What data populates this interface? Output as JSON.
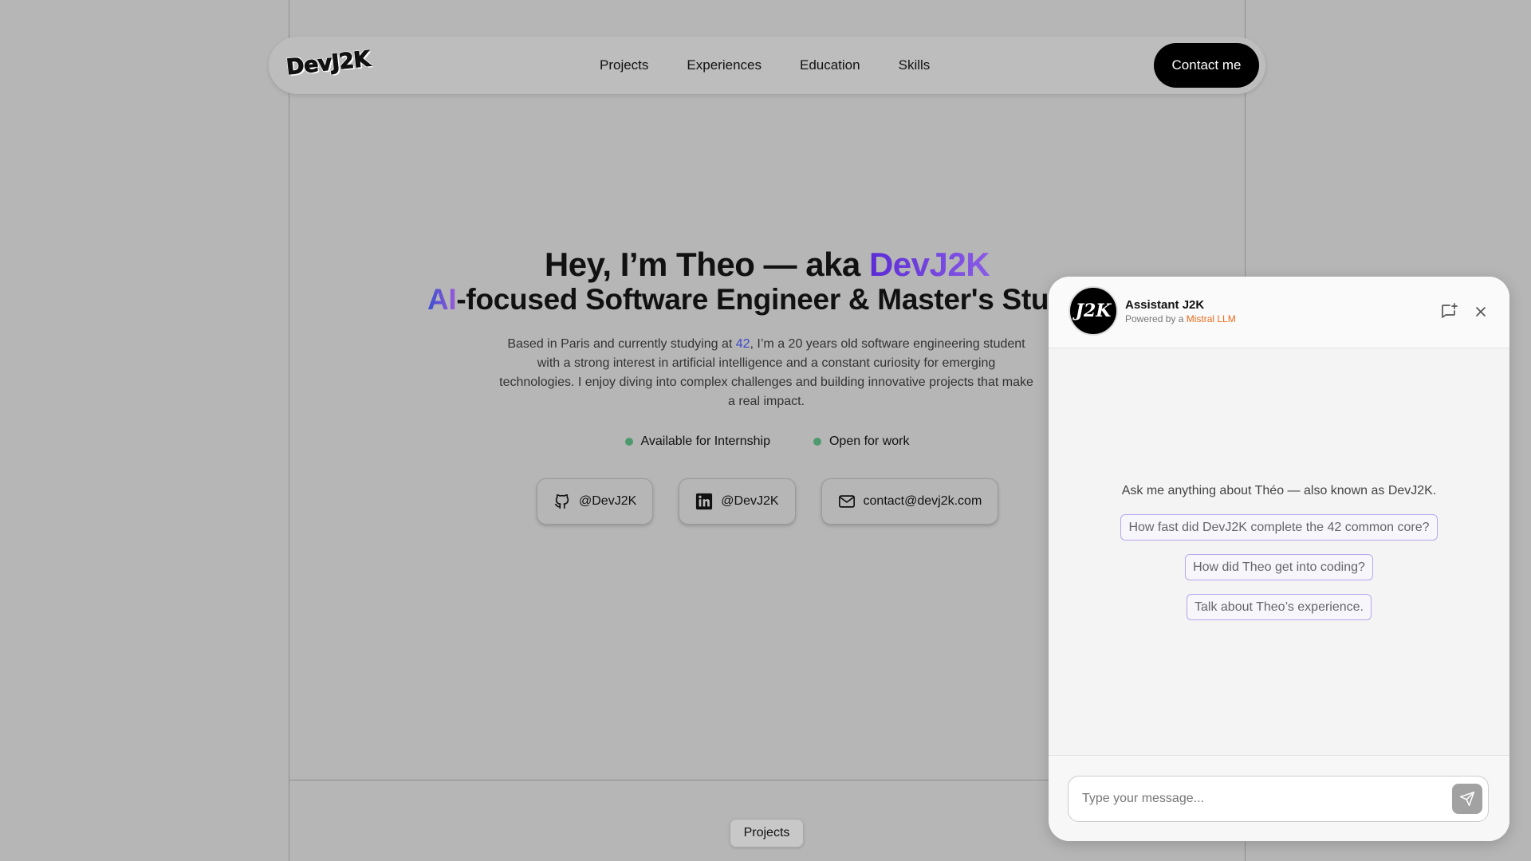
{
  "nav": {
    "logo": "DevJ2K",
    "links": [
      "Projects",
      "Experiences",
      "Education",
      "Skills"
    ],
    "contact_label": "Contact me"
  },
  "hero": {
    "title_prefix": "Hey, I’m Theo — aka ",
    "title_accent": "DevJ2K",
    "subtitle_ai": "AI",
    "subtitle_rest": "-focused Software Engineer & Master's Student",
    "desc_before": "Based in Paris and currently studying at ",
    "desc_link": "42",
    "desc_after": ", I’m a 20 years old software engineering student with a strong interest in artificial intelligence and a constant curiosity for emerging technologies. I enjoy diving into complex challenges and building innovative projects that make a real impact.",
    "status": [
      "Available for Internship",
      "Open for work"
    ],
    "socials": {
      "github": "@DevJ2K",
      "linkedin": "@DevJ2K",
      "email": "contact@devj2k.com"
    }
  },
  "section_chip": "Projects",
  "chat": {
    "avatar": "J2K",
    "title": "Assistant J2K",
    "powered_prefix": "Powered by a ",
    "powered_llm": "Mistral LLM",
    "intro": "Ask me anything about Théo — also known as DevJ2K.",
    "suggestions": [
      "How fast did DevJ2K complete the 42 common core?",
      "How did Theo get into coding?",
      "Talk about Theo’s experience."
    ],
    "input_placeholder": "Type your message..."
  },
  "colors": {
    "accent": "#6a3ddb",
    "status_dot": "#4e9a6e",
    "mistral": "#ee6a1a"
  }
}
